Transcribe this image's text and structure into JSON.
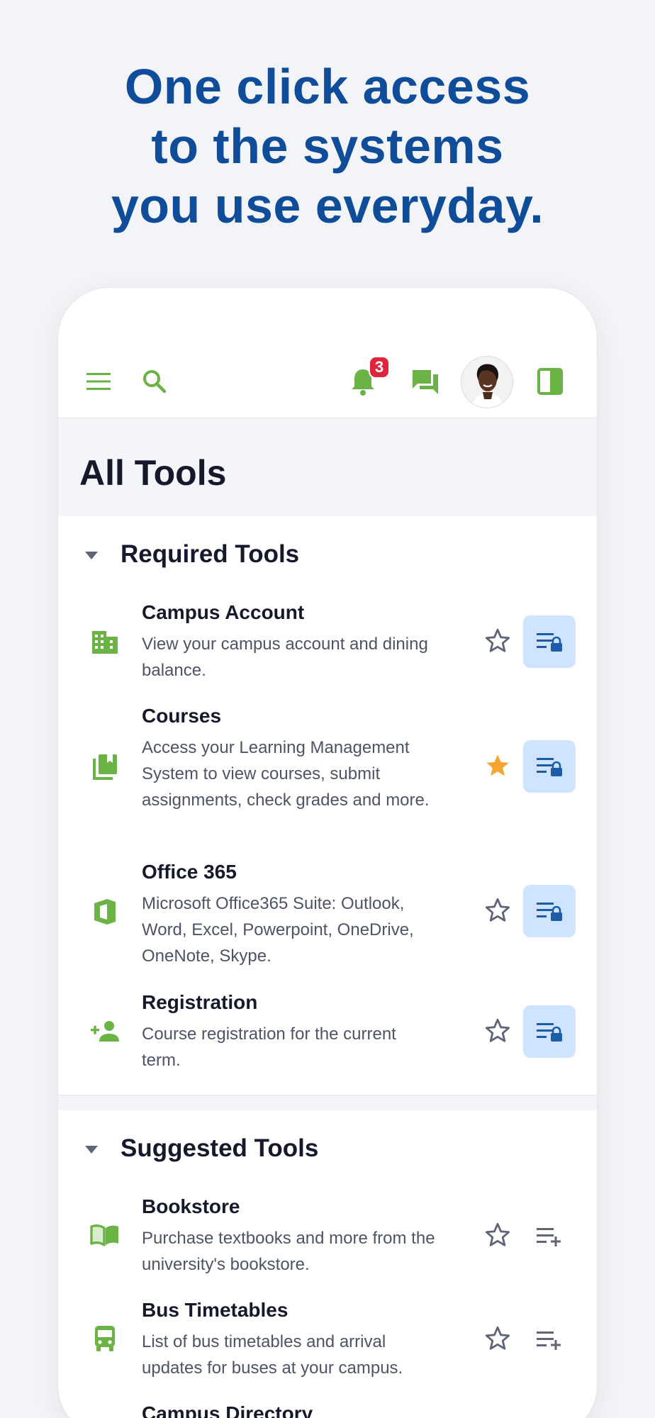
{
  "headline": {
    "line1": "One click access",
    "line2": "to the systems",
    "line3": "you use everyday."
  },
  "topbar": {
    "notification_count": "3",
    "icons": [
      "menu-icon",
      "search-icon",
      "bell-icon",
      "chat-icon",
      "avatar",
      "panel-toggle-icon"
    ]
  },
  "page_title": "All Tools",
  "required": {
    "title": "Required Tools",
    "tools": [
      {
        "name": "Campus Account",
        "desc": "View your campus account and dining balance.",
        "icon": "building-icon",
        "favorite": false,
        "action": "locked-list-icon"
      },
      {
        "name": "Courses",
        "desc": "Access your Learning Management System to view courses, submit assignments, check grades and more.",
        "icon": "library-icon",
        "favorite": true,
        "action": "locked-list-icon"
      },
      {
        "name": "Office 365",
        "desc": "Microsoft Office365 Suite: Outlook, Word, Excel, Powerpoint, OneDrive, OneNote, Skype.",
        "icon": "office-icon",
        "favorite": false,
        "action": "locked-list-icon"
      },
      {
        "name": "Registration",
        "desc": "Course registration for the current term.",
        "icon": "add-person-icon",
        "favorite": false,
        "action": "locked-list-icon"
      }
    ]
  },
  "suggested": {
    "title": "Suggested Tools",
    "tools": [
      {
        "name": "Bookstore",
        "desc": "Purchase textbooks and more from the university's bookstore.",
        "icon": "book-icon",
        "favorite": false,
        "action": "add-to-list-icon"
      },
      {
        "name": "Bus Timetables",
        "desc": "List of bus timetables and arrival updates for buses at your campus.",
        "icon": "bus-icon",
        "favorite": false,
        "action": "add-to-list-icon"
      },
      {
        "name": "Campus Directory",
        "desc": "",
        "icon": "",
        "favorite": false,
        "action": ""
      }
    ]
  },
  "colors": {
    "brand_blue": "#0f4c99",
    "icon_green": "#6ab344",
    "star_gold": "#f6a531",
    "badge_red": "#e0243b",
    "locked_bg": "#cfe5ff",
    "locked_icon": "#1e5ca8"
  }
}
